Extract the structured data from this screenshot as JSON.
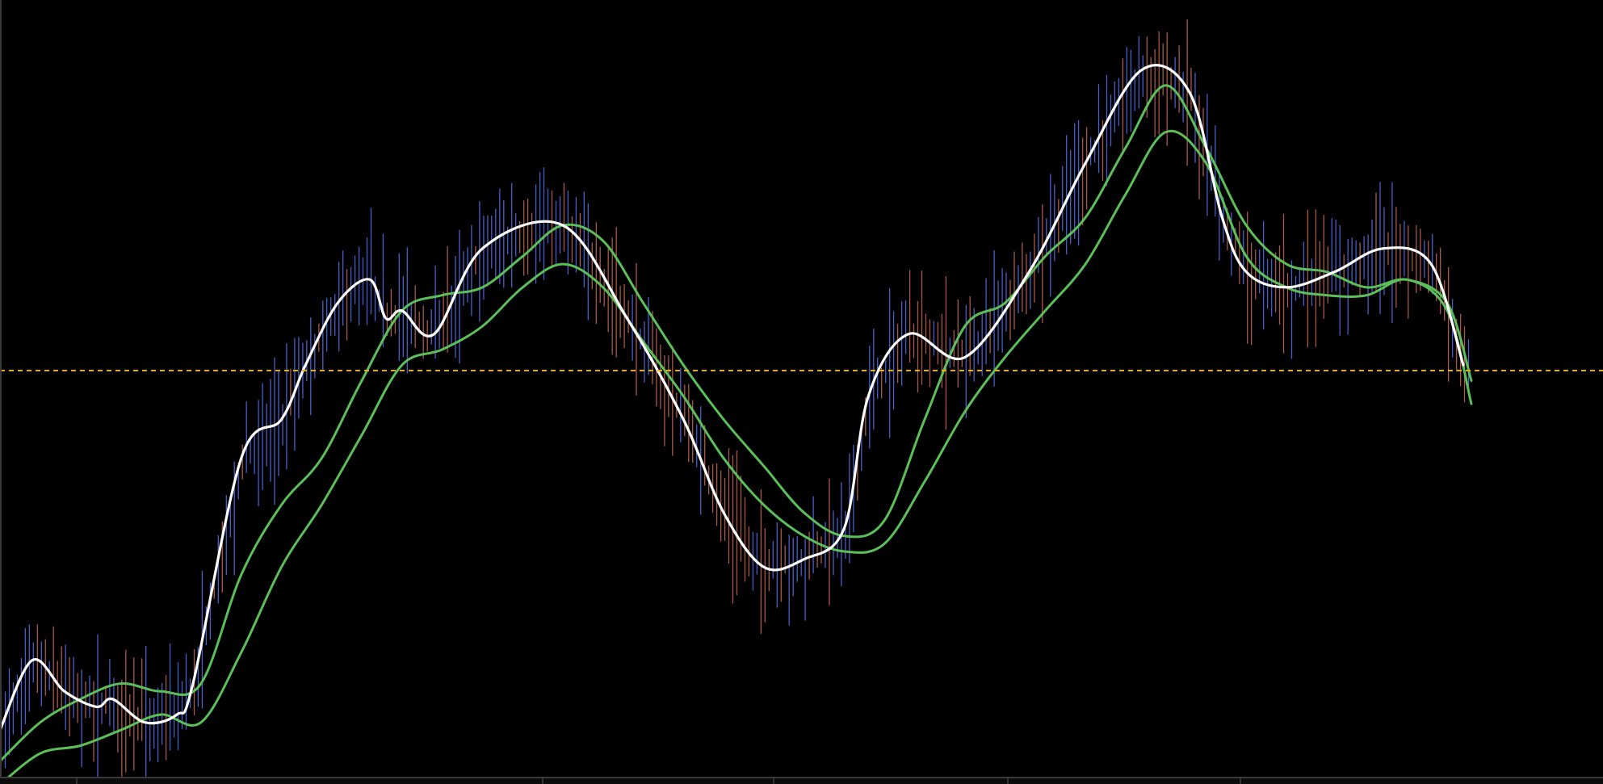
{
  "chart_data": {
    "type": "line",
    "title": "",
    "xlabel": "",
    "ylabel": "",
    "grid": false,
    "legend": "none",
    "x_range": [
      0,
      183
    ],
    "y_range": [
      0,
      100
    ],
    "background": "#000000",
    "colors": {
      "bar_up": "#4a5ec8",
      "bar_down": "#a8584a",
      "fast_line": "#ffffff",
      "slow_lines": "#5cbf5a",
      "level_line": "#e6b422",
      "frame": "#3a3a3a"
    },
    "level": 52.3,
    "series": [
      {
        "role": "fast",
        "style": "white",
        "x": [
          0,
          4,
          8,
          12,
          14,
          18,
          22,
          24,
          30,
          35,
          38,
          42,
          46,
          48,
          50,
          54,
          60,
          70,
          78,
          85,
          90,
          95,
          100,
          105,
          108,
          113,
          120,
          128,
          135,
          142,
          148,
          152,
          155,
          160,
          166,
          172,
          178,
          182
        ],
        "y": [
          6,
          15,
          11,
          9,
          10,
          7,
          8,
          12,
          41,
          46,
          53,
          61,
          64,
          59,
          60,
          57,
          68,
          71,
          59,
          46,
          34,
          27,
          28,
          32,
          49,
          57,
          54,
          65,
          79,
          91,
          88,
          72,
          65,
          63,
          65,
          68,
          66,
          53
        ]
      },
      {
        "role": "slow",
        "style": "green-upper",
        "x": [
          0,
          5,
          10,
          15,
          20,
          25,
          30,
          35,
          40,
          45,
          50,
          55,
          60,
          65,
          70,
          75,
          80,
          85,
          90,
          95,
          100,
          105,
          110,
          115,
          120,
          125,
          130,
          135,
          140,
          145,
          150,
          155,
          160,
          165,
          170,
          175,
          180,
          183
        ],
        "y": [
          2,
          7,
          10,
          12,
          11,
          12,
          26,
          35,
          41,
          51,
          60,
          62,
          63,
          67,
          71,
          69,
          61,
          53,
          46,
          40,
          34,
          31,
          33,
          46,
          58,
          61,
          67,
          72,
          81,
          89,
          81,
          71,
          66,
          65,
          63,
          64,
          61,
          51
        ]
      },
      {
        "role": "slow",
        "style": "green-lower",
        "x": [
          0,
          5,
          10,
          15,
          20,
          25,
          30,
          35,
          40,
          45,
          50,
          55,
          60,
          65,
          70,
          75,
          80,
          85,
          90,
          95,
          100,
          105,
          110,
          115,
          120,
          125,
          130,
          135,
          140,
          145,
          150,
          155,
          160,
          165,
          170,
          175,
          180,
          183
        ],
        "y": [
          -1,
          3,
          4,
          6,
          8,
          7,
          16,
          27,
          35,
          44,
          53,
          55,
          58,
          63,
          66,
          63,
          56,
          49,
          41,
          35,
          31,
          29,
          30,
          38,
          47,
          54,
          60,
          66,
          75,
          83,
          79,
          67,
          63,
          62,
          62,
          64,
          60,
          48
        ]
      }
    ]
  }
}
